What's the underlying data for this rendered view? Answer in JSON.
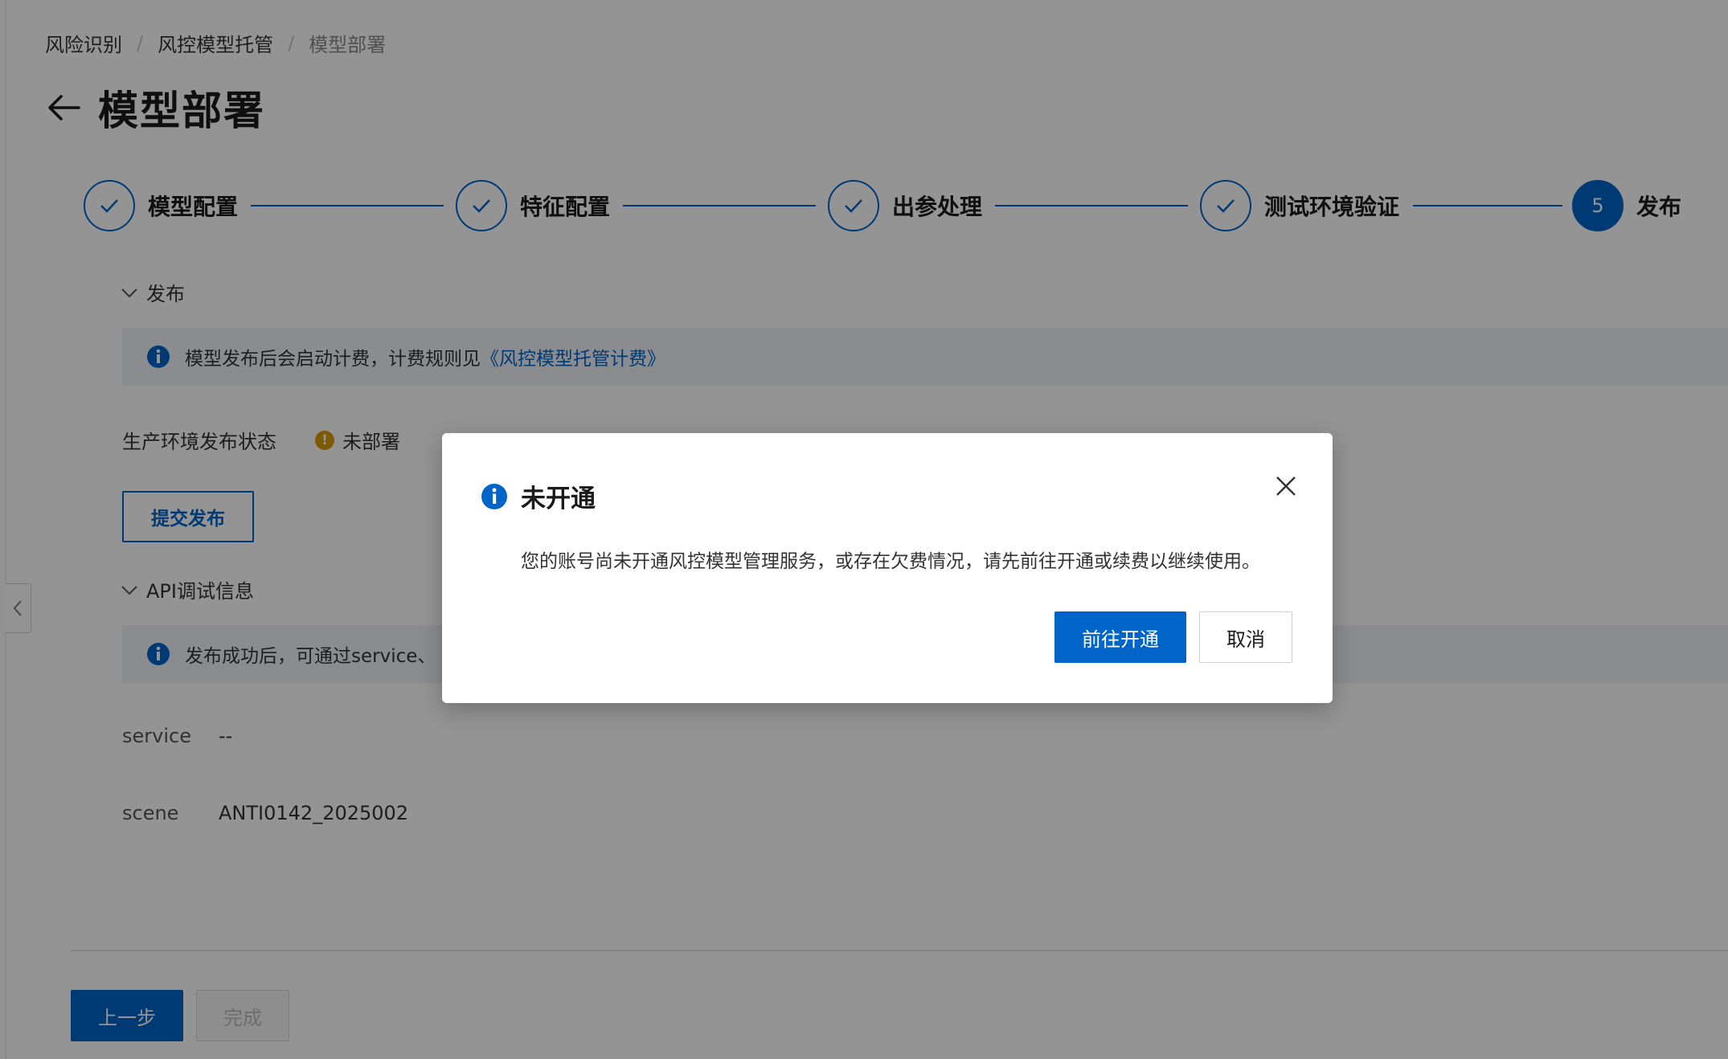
{
  "breadcrumb": {
    "items": [
      "风险识别",
      "风控模型托管",
      "模型部署"
    ],
    "separator": "/"
  },
  "header": {
    "title": "模型部署",
    "back_icon": "arrow-left-icon"
  },
  "steps": [
    {
      "label": "模型配置",
      "status": "done"
    },
    {
      "label": "特征配置",
      "status": "done"
    },
    {
      "label": "出参处理",
      "status": "done"
    },
    {
      "label": "测试环境验证",
      "status": "done"
    },
    {
      "label": "发布",
      "status": "active",
      "number": "5"
    }
  ],
  "publish_section": {
    "title": "发布",
    "info_text": "模型发布后会启动计费，计费规则见",
    "info_link": "《风控模型托管计费》",
    "status_label": "生产环境发布状态",
    "status_value": "未部署",
    "status_icon": "!",
    "submit_label": "提交发布"
  },
  "api_section": {
    "title": "API调试信息",
    "info_text": "发布成功后，可通过service、",
    "fields": [
      {
        "key": "service",
        "value": "--"
      },
      {
        "key": "scene",
        "value": "ANTI0142_2025002"
      }
    ]
  },
  "footer": {
    "prev_label": "上一步",
    "done_label": "完成"
  },
  "modal": {
    "title": "未开通",
    "message": "您的账号尚未开通风控模型管理服务，或存在欠费情况，请先前往开通或续费以继续使用。",
    "primary_label": "前往开通",
    "cancel_label": "取消"
  },
  "colors": {
    "accent": "#0064c8",
    "warning": "#d79b00",
    "info_bg": "#eef2f9",
    "overlay": "rgba(0,0,0,0.42)"
  }
}
